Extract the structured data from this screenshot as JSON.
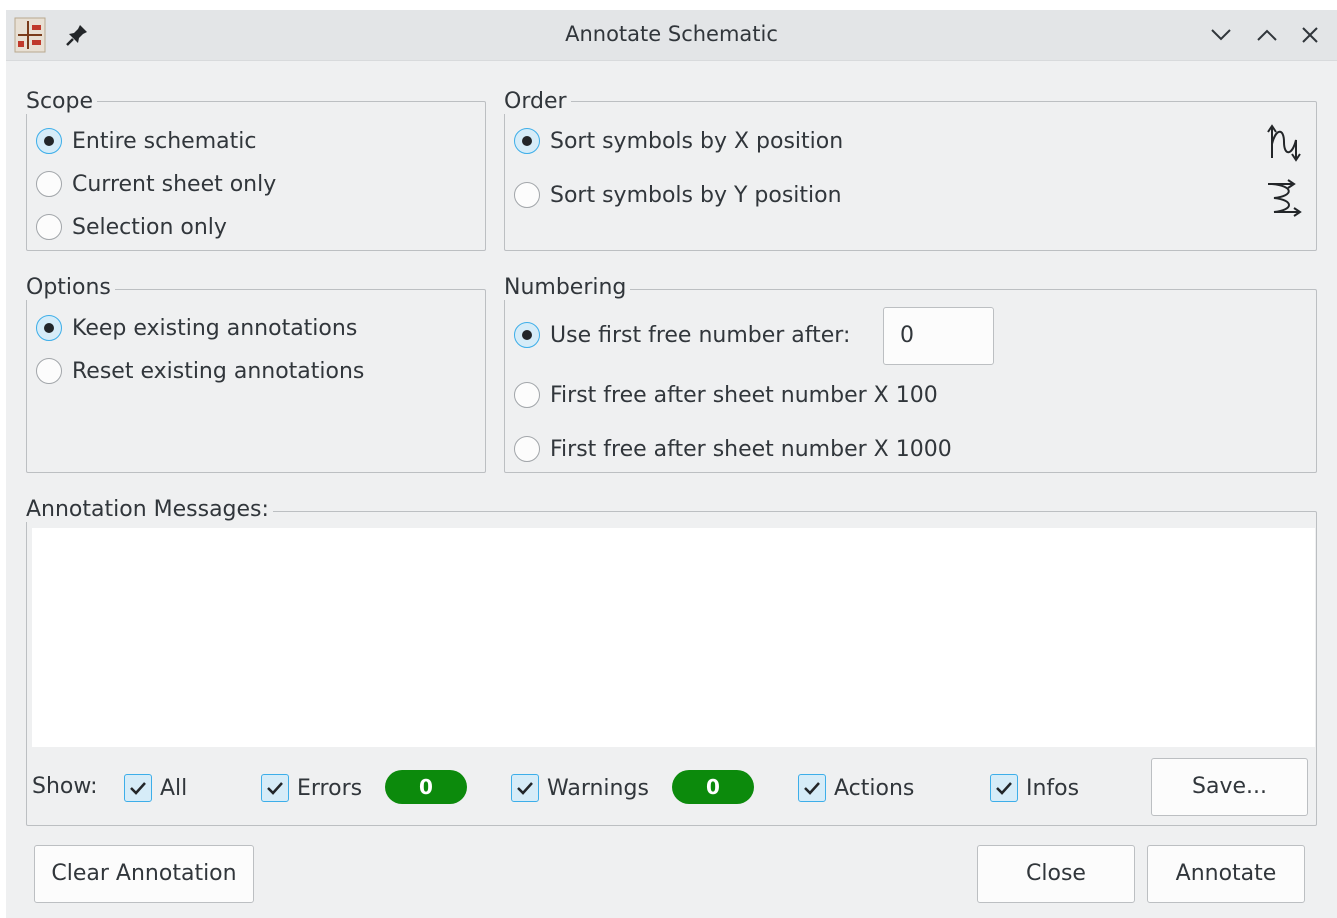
{
  "window": {
    "title": "Annotate Schematic"
  },
  "scope": {
    "label": "Scope",
    "options": [
      {
        "label": "Entire schematic",
        "checked": true
      },
      {
        "label": "Current sheet only",
        "checked": false
      },
      {
        "label": "Selection only",
        "checked": false
      }
    ]
  },
  "order": {
    "label": "Order",
    "options": [
      {
        "label": "Sort symbols by X position",
        "checked": true,
        "icon": "sort-x-icon"
      },
      {
        "label": "Sort symbols by Y position",
        "checked": false,
        "icon": "sort-y-icon"
      }
    ]
  },
  "options": {
    "label": "Options",
    "options": [
      {
        "label": "Keep existing annotations",
        "checked": true
      },
      {
        "label": "Reset existing annotations",
        "checked": false
      }
    ]
  },
  "numbering": {
    "label": "Numbering",
    "options": [
      {
        "label": "Use first free number after:",
        "checked": true
      },
      {
        "label": "First free after sheet number X 100",
        "checked": false
      },
      {
        "label": "First free after sheet number X 1000",
        "checked": false
      }
    ],
    "start_value": "0"
  },
  "messages": {
    "label": "Annotation Messages:",
    "show_label": "Show:",
    "filters": [
      {
        "label": "All",
        "checked": true
      },
      {
        "label": "Errors",
        "checked": true,
        "count": "0"
      },
      {
        "label": "Warnings",
        "checked": true,
        "count": "0"
      },
      {
        "label": "Actions",
        "checked": true
      },
      {
        "label": "Infos",
        "checked": true
      }
    ],
    "save_label": "Save..."
  },
  "buttons": {
    "clear": "Clear Annotation",
    "close": "Close",
    "annotate": "Annotate"
  },
  "colors": {
    "accent": "#3daee9",
    "badge": "#0c8a0c",
    "background": "#eff0f1"
  }
}
